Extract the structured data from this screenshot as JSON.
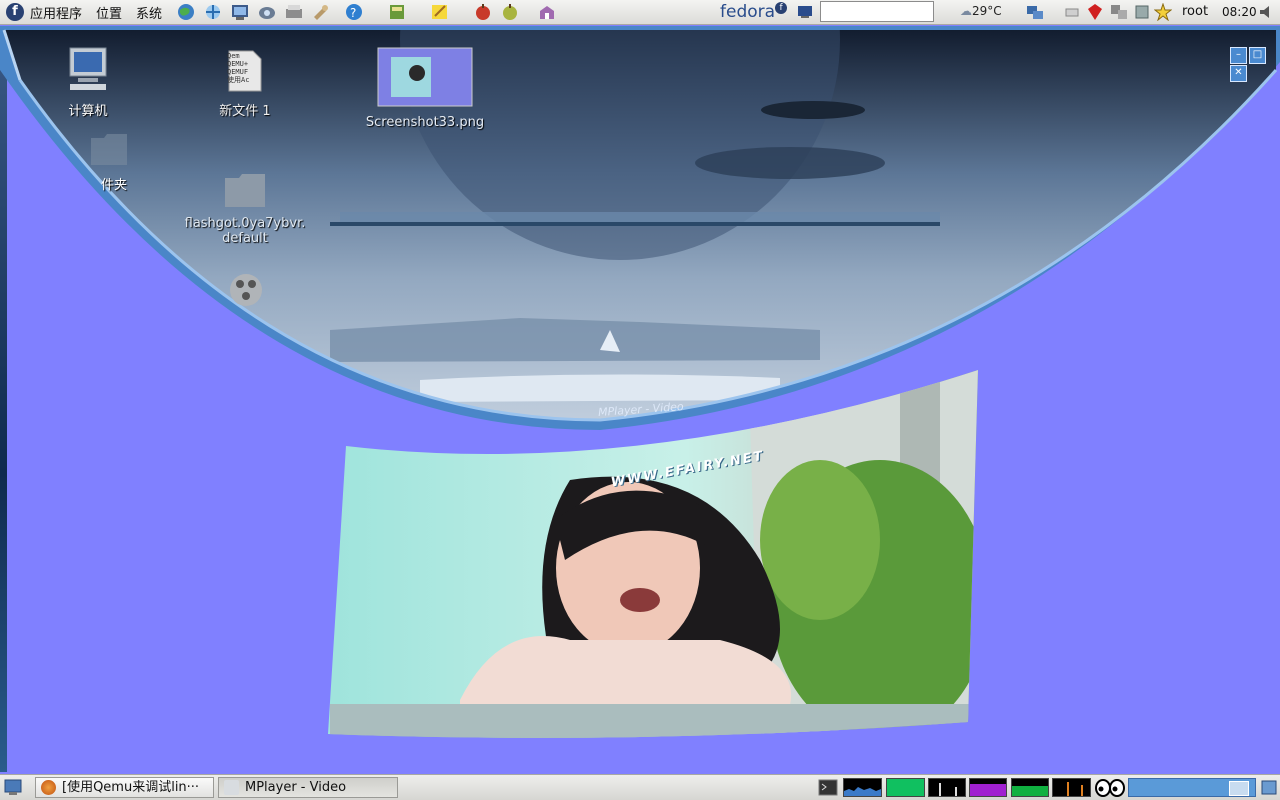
{
  "top_panel": {
    "menus": [
      "应用程序",
      "位置",
      "系统"
    ],
    "launchers": [
      "globe-icon",
      "network-icon",
      "screenshot-icon",
      "camera-icon",
      "scanner-icon",
      "wrench-icon",
      "help-icon",
      "book-icon",
      "notes-icon",
      "apple-icon",
      "fruit-icon",
      "package-icon"
    ],
    "brand": "fedora",
    "search_value": "",
    "weather": "29°C",
    "user": "root",
    "clock": "08:20"
  },
  "desktop": {
    "icons": [
      {
        "label": "计算机"
      },
      {
        "label": "新文件 1"
      },
      {
        "label": "Screenshot33.png"
      },
      {
        "label": "件夹"
      },
      {
        "label": "flashgot.0ya7ybvr.\ndefault"
      }
    ],
    "new_file_preview": "Qem\nQEMU+\nQEMUF\n使用Ac",
    "video_caption": "MPlayer - Video",
    "video_subtitle": "WWW.EFAIRY.NET"
  },
  "taskbar": {
    "tasks": [
      {
        "label": "[使用Qemu来调试lin···",
        "active": false
      },
      {
        "label": "MPlayer - Video",
        "active": true
      }
    ]
  },
  "colors": {
    "background": "#8080ff",
    "panel": "#e6e6e2",
    "fedora_blue": "#294172"
  }
}
